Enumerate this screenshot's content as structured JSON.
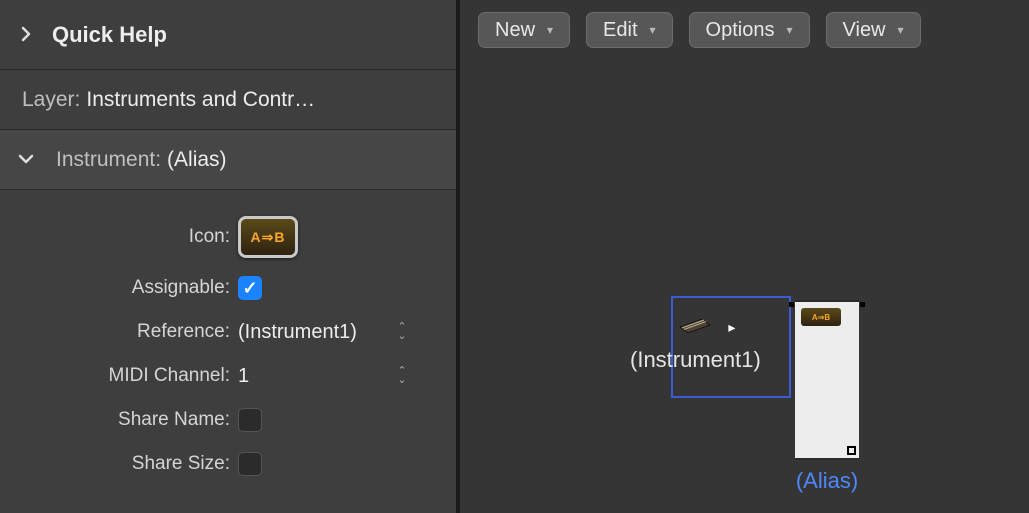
{
  "quick_help": {
    "title": "Quick Help"
  },
  "layer": {
    "label": "Layer:",
    "value": "Instruments and Contr…"
  },
  "instrument": {
    "label": "Instrument:",
    "value": "(Alias)"
  },
  "props": {
    "icon": {
      "label": "Icon:",
      "glyph": "A⇒B"
    },
    "assignable": {
      "label": "Assignable:",
      "checked": true
    },
    "reference": {
      "label": "Reference:",
      "value": "(Instrument1)"
    },
    "midi_channel": {
      "label": "MIDI Channel:",
      "value": "1"
    },
    "share_name": {
      "label": "Share Name:",
      "checked": false
    },
    "share_size": {
      "label": "Share Size:",
      "checked": false
    }
  },
  "toolbar": {
    "new": "New",
    "edit": "Edit",
    "options": "Options",
    "view": "View"
  },
  "canvas": {
    "instrument1_label": "(Instrument1)",
    "alias_label": "(Alias)",
    "alias_mini_glyph": "A⇒B"
  }
}
